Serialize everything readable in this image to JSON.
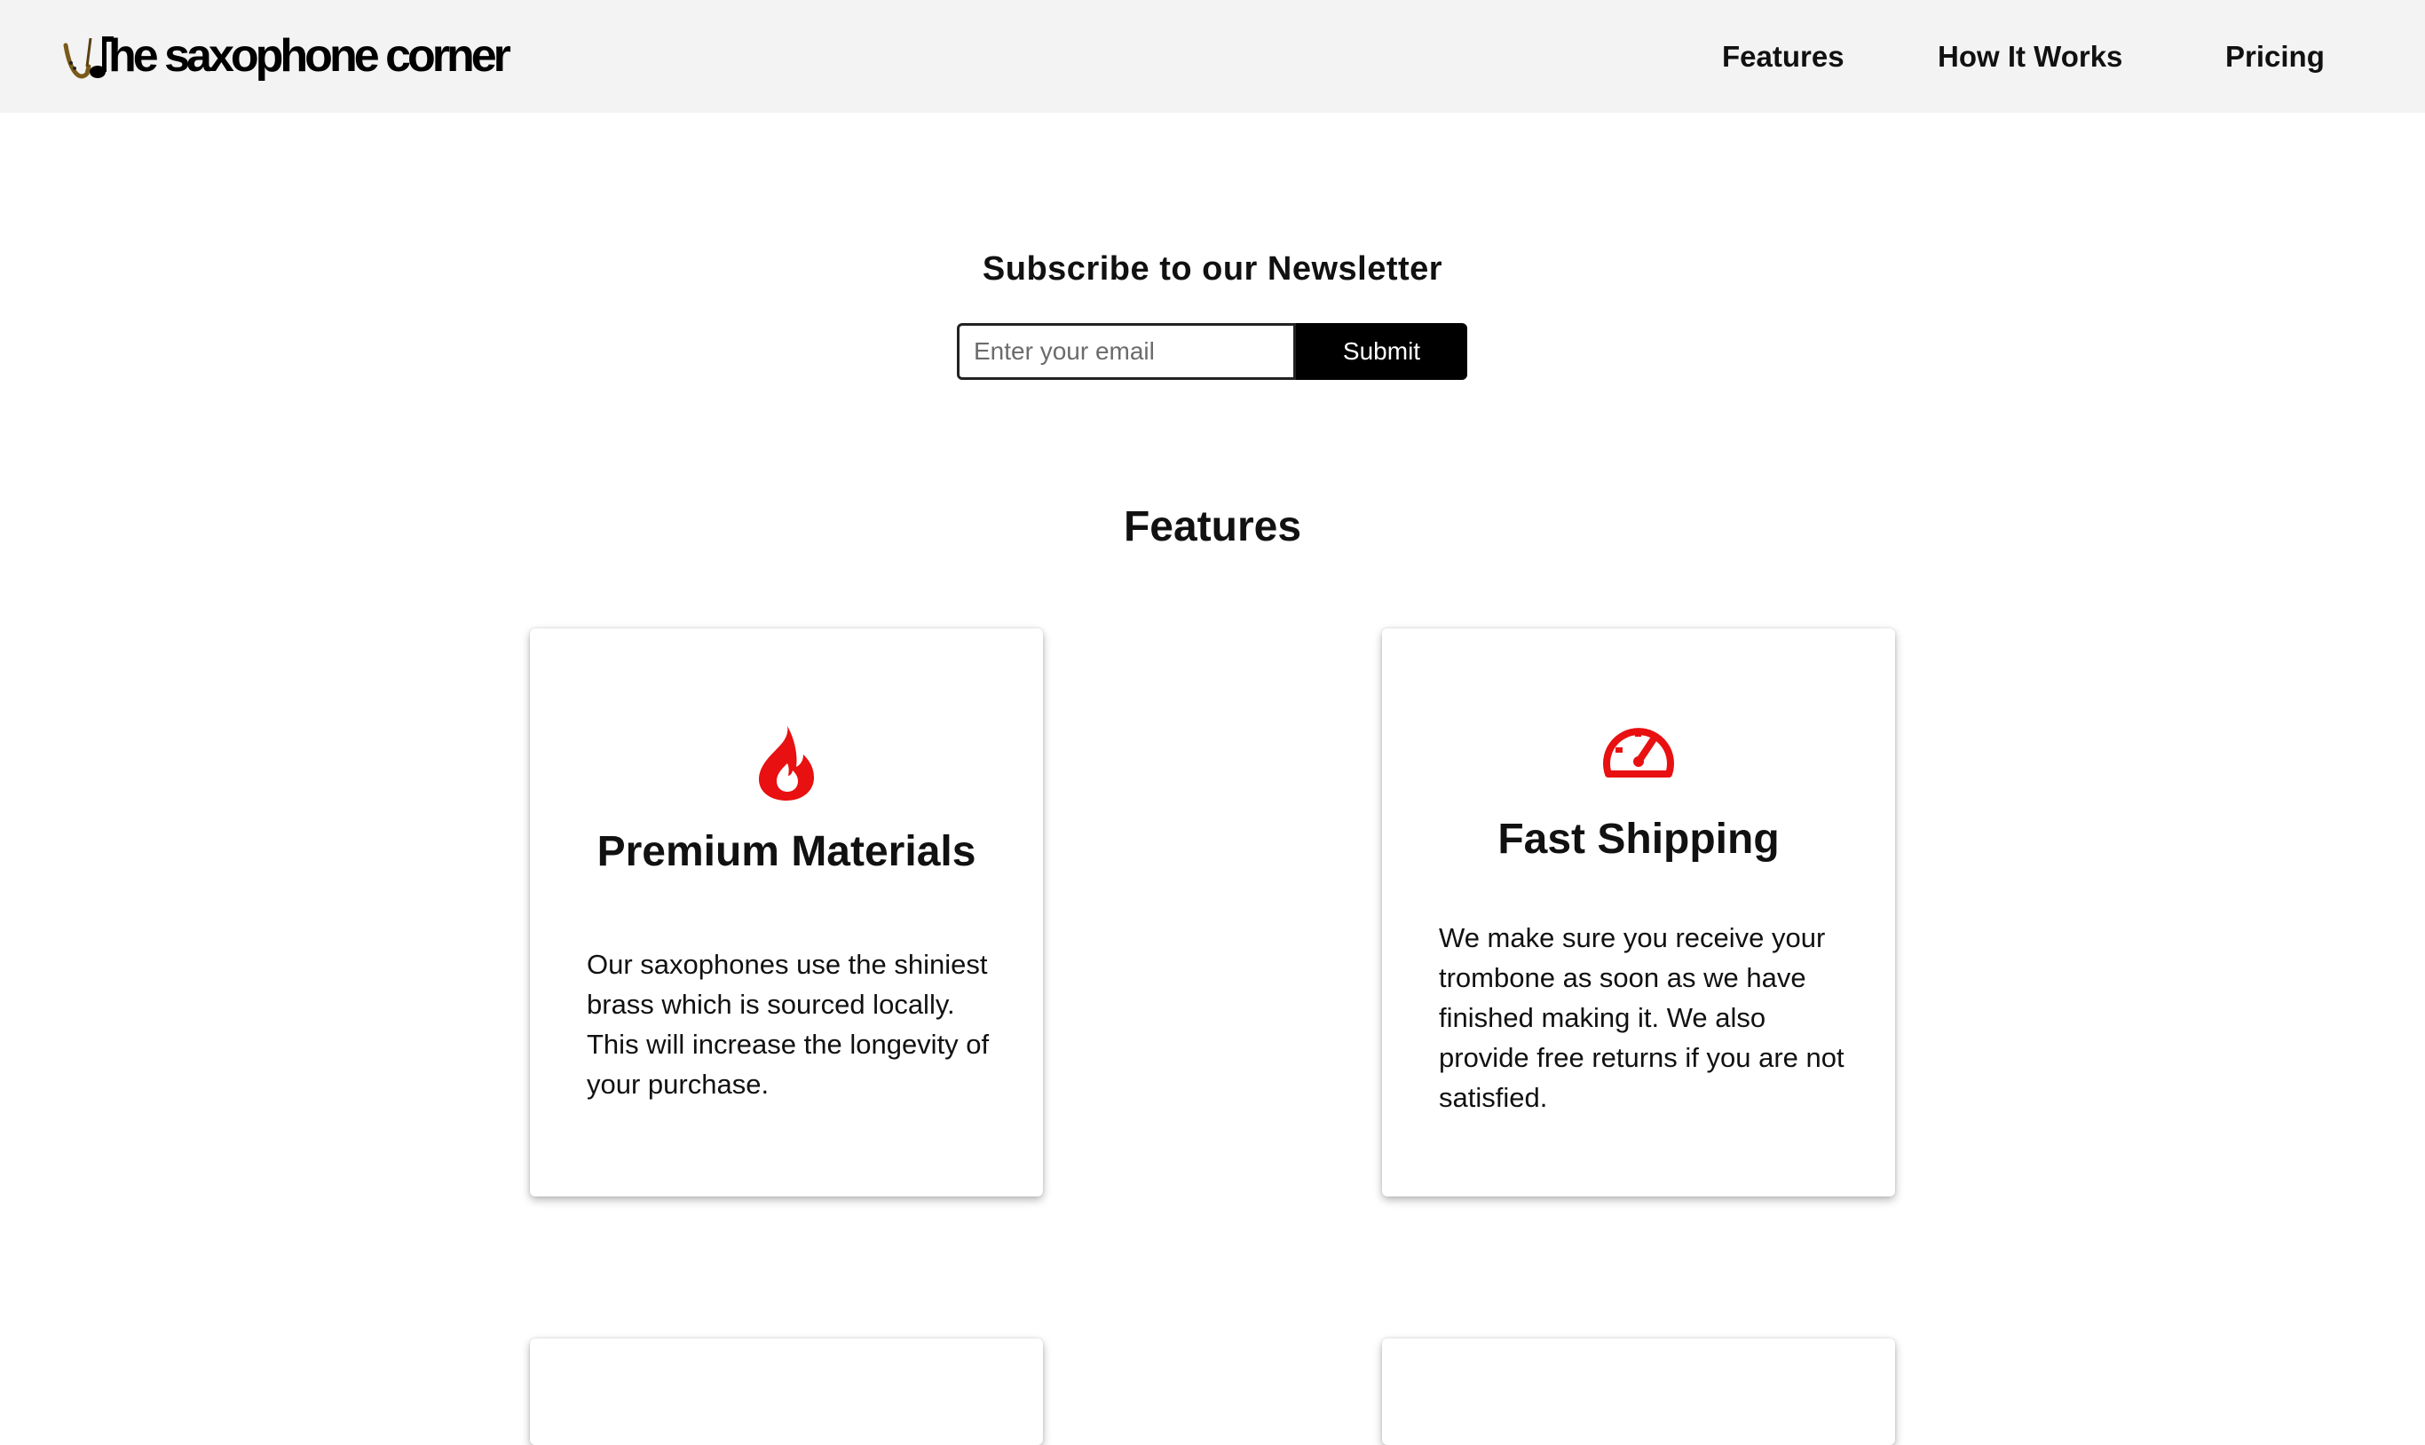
{
  "header": {
    "logo_text": "he saxophone corner",
    "nav": {
      "features": "Features",
      "how_it_works": "How It Works",
      "pricing": "Pricing"
    }
  },
  "newsletter": {
    "title": "Subscribe to our Newsletter",
    "email_placeholder": "Enter your email",
    "submit_label": "Submit"
  },
  "features": {
    "title": "Features",
    "accent_color": "#e81010",
    "cards": [
      {
        "icon": "flame-icon",
        "title": "Premium Materials",
        "text": "Our saxophones use the shiniest brass which is sourced locally. This will increase the longevity of your purchase."
      },
      {
        "icon": "speedometer-icon",
        "title": "Fast Shipping",
        "text": "We make sure you receive your trombone as soon as we have finished making it. We also provide free returns if you are not satisfied."
      }
    ]
  }
}
